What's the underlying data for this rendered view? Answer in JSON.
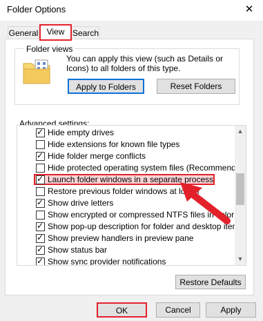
{
  "window": {
    "title": "Folder Options",
    "close_glyph": "✕"
  },
  "tabs": [
    {
      "label": "General"
    },
    {
      "label": "View"
    },
    {
      "label": "Search"
    }
  ],
  "folder_views": {
    "group_label": "Folder views",
    "description": "You can apply this view (such as Details or Icons) to all folders of this type.",
    "apply_button": "Apply to Folders",
    "reset_button": "Reset Folders"
  },
  "advanced": {
    "label": "Advanced settings:",
    "items": [
      {
        "label": "Hide empty drives",
        "checked": true
      },
      {
        "label": "Hide extensions for known file types",
        "checked": false
      },
      {
        "label": "Hide folder merge conflicts",
        "checked": true
      },
      {
        "label": "Hide protected operating system files (Recommended)",
        "checked": false
      },
      {
        "label": "Launch folder windows in a separate process",
        "checked": true,
        "highlighted": true
      },
      {
        "label": "Restore previous folder windows at logon",
        "checked": false
      },
      {
        "label": "Show drive letters",
        "checked": true
      },
      {
        "label": "Show encrypted or compressed NTFS files in color",
        "checked": false
      },
      {
        "label": "Show pop-up description for folder and desktop items",
        "checked": true
      },
      {
        "label": "Show preview handlers in preview pane",
        "checked": true
      },
      {
        "label": "Show status bar",
        "checked": true
      },
      {
        "label": "Show sync provider notifications",
        "checked": true
      }
    ],
    "restore_button": "Restore Defaults"
  },
  "footer": {
    "ok": "OK",
    "cancel": "Cancel",
    "apply": "Apply"
  },
  "colors": {
    "highlight": "#e3212b",
    "focus": "#0b71d6"
  }
}
